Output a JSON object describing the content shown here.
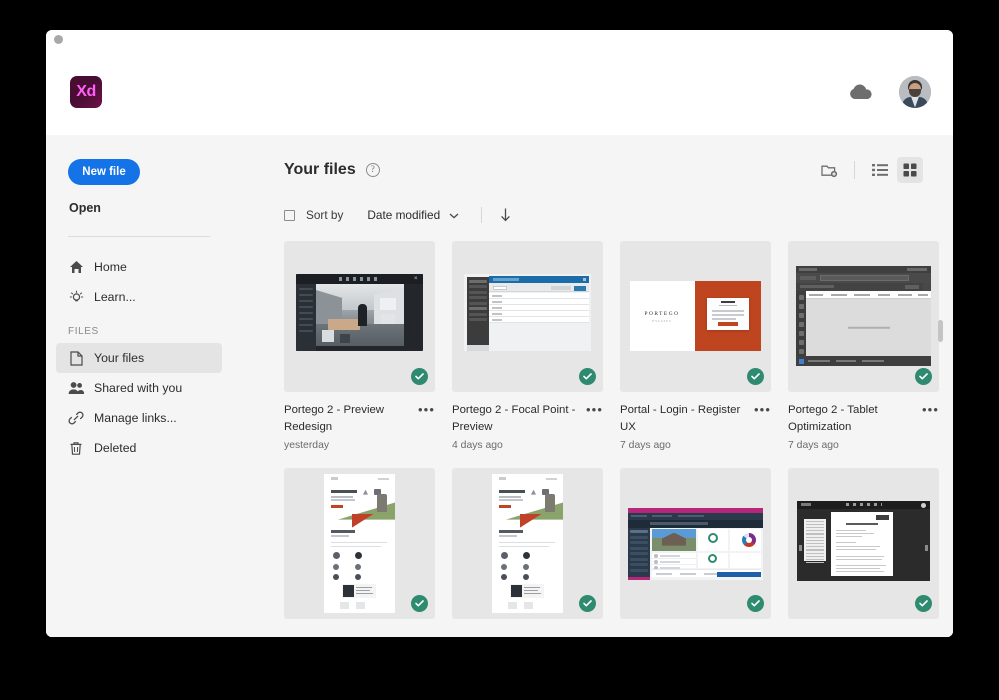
{
  "window": {
    "control_dot": "window-dot"
  },
  "header": {
    "logo_text": "Xd",
    "logo_bg": "#470d33",
    "logo_fg": "#ff61f6",
    "cloud_icon": "cloud-icon",
    "avatar": "user-avatar"
  },
  "sidebar": {
    "new_file_label": "New file",
    "new_file_color": "#1473E6",
    "open_label": "Open",
    "nav": [
      {
        "label": "Home",
        "icon": "home-icon",
        "active": false
      },
      {
        "label": "Learn...",
        "icon": "lightbulb-icon",
        "active": false
      }
    ],
    "section_label": "FILES",
    "files_nav": [
      {
        "label": "Your files",
        "icon": "document-icon",
        "active": true
      },
      {
        "label": "Shared with you",
        "icon": "people-icon",
        "active": false
      },
      {
        "label": "Manage links...",
        "icon": "link-icon",
        "active": false
      },
      {
        "label": "Deleted",
        "icon": "trash-icon",
        "active": false
      }
    ]
  },
  "content": {
    "title": "Your files",
    "help_icon": "?",
    "tools": [
      {
        "name": "new-folder-icon",
        "selected": false
      },
      {
        "name": "list-view-icon",
        "selected": false
      },
      {
        "name": "grid-view-icon",
        "selected": true
      }
    ],
    "sort": {
      "select_all_label": "",
      "sort_by_label": "Sort by",
      "sort_value": "Date modified",
      "chevron": "chevron-down-icon",
      "direction_icon": "arrow-down-icon"
    }
  },
  "files": [
    {
      "title": "Portego 2 - Preview Redesign",
      "date": "yesterday",
      "menu": "•••",
      "badge": "cloud-synced-check",
      "thumb": "tb1"
    },
    {
      "title": "Portego 2 - Focal Point - Preview",
      "date": "4 days ago",
      "menu": "•••",
      "badge": "cloud-synced-check",
      "thumb": "tb2"
    },
    {
      "title": "Portal - Login - Register UX",
      "date": "7 days ago",
      "menu": "•••",
      "badge": "cloud-synced-check",
      "thumb": "tb3"
    },
    {
      "title": "Portego 2 - Tablet Optimization",
      "date": "7 days ago",
      "menu": "•••",
      "badge": "cloud-synced-check",
      "thumb": "tb4"
    },
    {
      "title": "",
      "date": "",
      "menu": "•••",
      "badge": "cloud-synced-check",
      "thumb": "tb5"
    },
    {
      "title": "",
      "date": "",
      "menu": "•••",
      "badge": "cloud-synced-check",
      "thumb": "tb6"
    },
    {
      "title": "",
      "date": "",
      "menu": "•••",
      "badge": "cloud-synced-check",
      "thumb": "tb7"
    },
    {
      "title": "",
      "date": "",
      "menu": "•••",
      "badge": "cloud-synced-check",
      "thumb": "tb8"
    }
  ],
  "thumb_text": {
    "portego_wordmark": "PORTEGO",
    "portego_sub": "ESTATES"
  },
  "colors": {
    "accent_blue": "#1473E6",
    "badge_green": "#2E8B6F",
    "brand_orange": "#BF4520",
    "page_bg": "#F5F5F5",
    "thumb_bg": "#E6E6E6"
  }
}
